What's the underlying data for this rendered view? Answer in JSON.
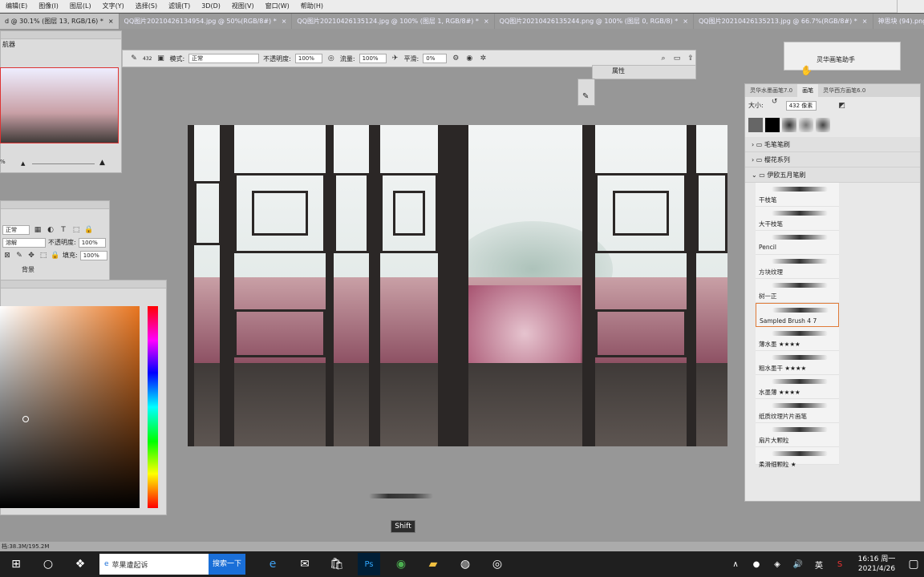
{
  "menu": [
    "编辑(E)",
    "图像(I)",
    "图层(L)",
    "文字(Y)",
    "选择(S)",
    "滤镜(T)",
    "3D(D)",
    "视图(V)",
    "窗口(W)",
    "帮助(H)"
  ],
  "tabs": [
    {
      "label": "d @ 30.1% (图层 13, RGB/16) *",
      "active": true
    },
    {
      "label": "QQ图片20210426134954.jpg @ 50%(RGB/8#) *",
      "active": false
    },
    {
      "label": "QQ图片20210426135124.jpg @ 100% (图层 1, RGB/8#) *",
      "active": false
    },
    {
      "label": "QQ图片20210426135244.png @ 100% (图层 0, RGB/8) *",
      "active": false
    },
    {
      "label": "QQ图片20210426135213.jpg @ 66.7%(RGB/8#) *",
      "active": false
    },
    {
      "label": "神思块 (94).png @ 12.2% (图层 0, RGB/8)",
      "active": false
    }
  ],
  "options": {
    "brush_size": "432",
    "mode_label": "模式:",
    "mode_value": "正常",
    "opacity_label": "不透明度:",
    "opacity_value": "100%",
    "flow_label": "流量:",
    "flow_value": "100%",
    "smooth_label": "平滑:",
    "smooth_value": "0%"
  },
  "properties": {
    "label": "属性"
  },
  "helper": {
    "label": "灵华画笔助手"
  },
  "navigator": {
    "title": "航器",
    "zoom": "%"
  },
  "layers": {
    "mode": "正常",
    "blend": "溶解",
    "opacity_label": "不透明度:",
    "opacity_value": "100%",
    "fill_label": "填充:",
    "fill_value": "100%",
    "layer_name": "背景"
  },
  "brushes": {
    "tabs": [
      "灵华水墨画笔7.0",
      "画笔",
      "灵华西方画笔6.0"
    ],
    "size_label": "大小:",
    "size_value": "432 像素",
    "folders": [
      "毛笔笔刷",
      "樱花系列",
      "伊欧五月笔刷"
    ],
    "items": [
      "干枝笔",
      "大干枝笔",
      "Pencil",
      "方块纹理",
      "树一正",
      "Sampled Brush 4 7",
      "薄水墨 ★★★★",
      "粗水墨干 ★★★★",
      "水墨薄 ★★★★",
      "纸质纹理片片画笔",
      "扇片大颗粒",
      "柔滑细颗粒 ★"
    ]
  },
  "status": {
    "doc": "档:38.3M/195.2M"
  },
  "tooltip": "Shift",
  "taskbar": {
    "search_text": "苹果遭起诉",
    "search_button": "搜索一下",
    "time": "16:16 周一",
    "date": "2021/4/26",
    "ime": "英"
  }
}
